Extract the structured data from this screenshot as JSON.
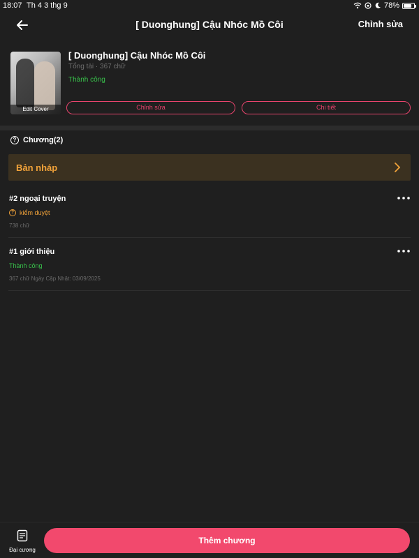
{
  "status_bar": {
    "time": "18:07",
    "date": "Th 4 3 thg 9",
    "battery": "78%",
    "battery_level": 0.78
  },
  "nav": {
    "title": "[ Duonghung] Cậu Nhóc Mồ Côi",
    "edit_label": "Chỉnh sửa",
    "back_icon": "arrow-left-icon"
  },
  "book": {
    "title": "[ Duonghung] Cậu Nhóc Mồ Côi",
    "meta": "Tổng tài · 367 chữ",
    "status": "Thành công",
    "edit_cover_label": "Edit Cover",
    "edit_button": "Chỉnh sửa",
    "detail_button": "Chi tiết"
  },
  "chapters": {
    "header": "Chương(2)",
    "draft_label": "Bản nháp",
    "items": [
      {
        "title": "#2 ngoại truyện",
        "status": "kiểm duyệt",
        "meta": "738 chữ"
      },
      {
        "title": "#1 giới thiệu",
        "status": "Thành công",
        "meta": "367 chữ Ngày Cập Nhật: 03/09/2025"
      }
    ]
  },
  "bottom": {
    "outline_label": "Đại cương",
    "add_button": "Thêm chương"
  },
  "colors": {
    "background": "#1f1f1f",
    "accent": "#f2496d",
    "success": "#38c24b",
    "pending": "#f2a33a",
    "draft_bg": "#3b3120"
  }
}
